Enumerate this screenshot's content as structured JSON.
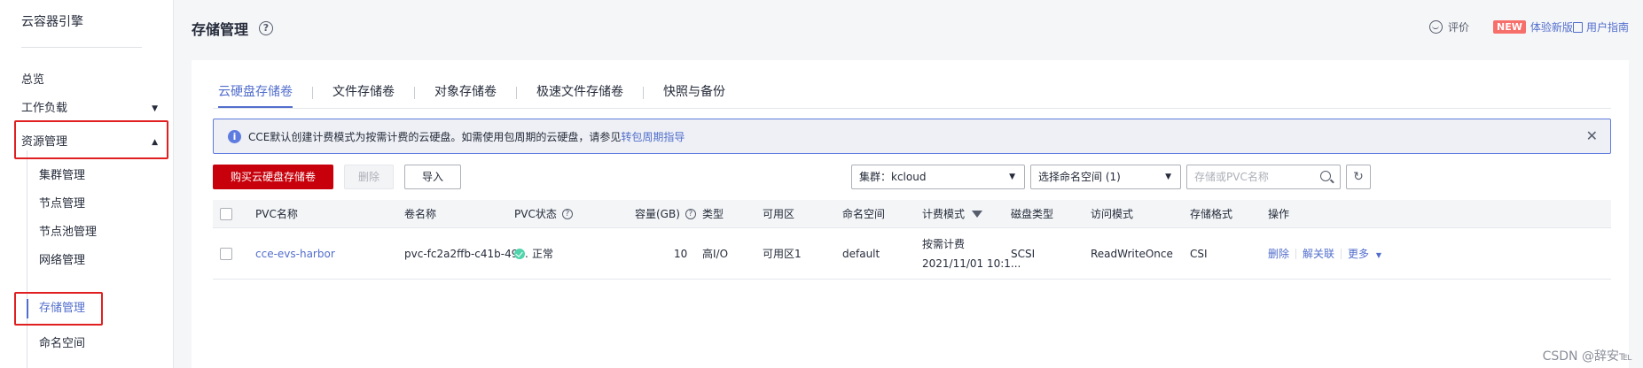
{
  "sidebar": {
    "title": "云容器引擎",
    "items": [
      {
        "label": "总览"
      },
      {
        "label": "工作负载"
      },
      {
        "label": "资源管理"
      }
    ],
    "sub_items": [
      {
        "label": "集群管理"
      },
      {
        "label": "节点管理"
      },
      {
        "label": "节点池管理"
      },
      {
        "label": "网络管理"
      },
      {
        "label": "存储管理"
      },
      {
        "label": "命名空间"
      }
    ]
  },
  "header": {
    "title": "存储管理",
    "help_glyph": "?",
    "rate_label": "评价",
    "new_badge": "NEW",
    "new_link": "体验新版",
    "guide_link": "用户指南"
  },
  "tabs": [
    {
      "label": "云硬盘存储卷"
    },
    {
      "label": "文件存储卷"
    },
    {
      "label": "对象存储卷"
    },
    {
      "label": "极速文件存储卷"
    },
    {
      "label": "快照与备份"
    }
  ],
  "notice": {
    "text": "CCE默认创建计费模式为按需计费的云硬盘。如需使用包周期的云硬盘，请参见 ",
    "link": "转包周期指导",
    "close_glyph": "✕"
  },
  "toolbar": {
    "buy_label": "购买云硬盘存储卷",
    "delete_label": "删除",
    "import_label": "导入",
    "cluster_select": "集群：kcloud",
    "namespace_select": "选择命名空间 (1)",
    "search_placeholder": "存储或PVC名称"
  },
  "table": {
    "columns": [
      "PVC名称",
      "卷名称",
      "PVC状态",
      "容量(GB)",
      "类型",
      "可用区",
      "命名空间",
      "计费模式",
      "磁盘类型",
      "访问模式",
      "存储格式",
      "操作"
    ],
    "rows": [
      {
        "pvc_name": "cce-evs-harbor",
        "volume_name": "pvc-fc2a2ffb-c41b-49...",
        "status": "正常",
        "capacity": "10",
        "type": "高I/O",
        "zone": "可用区1",
        "namespace": "default",
        "billing_mode": "按需计费",
        "billing_time": "2021/11/01 10:1...",
        "disk_type": "SCSI",
        "access_mode": "ReadWriteOnce",
        "storage_format": "CSI",
        "ops": {
          "delete": "删除",
          "unbind": "解关联",
          "more": "更多"
        }
      }
    ]
  },
  "watermark": "CSDN @辞安℡",
  "colors": {
    "accent": "#526ecc",
    "primary_button": "#c7000b",
    "annotation_box": "#e02020",
    "status_ok": "#50d4ab"
  }
}
